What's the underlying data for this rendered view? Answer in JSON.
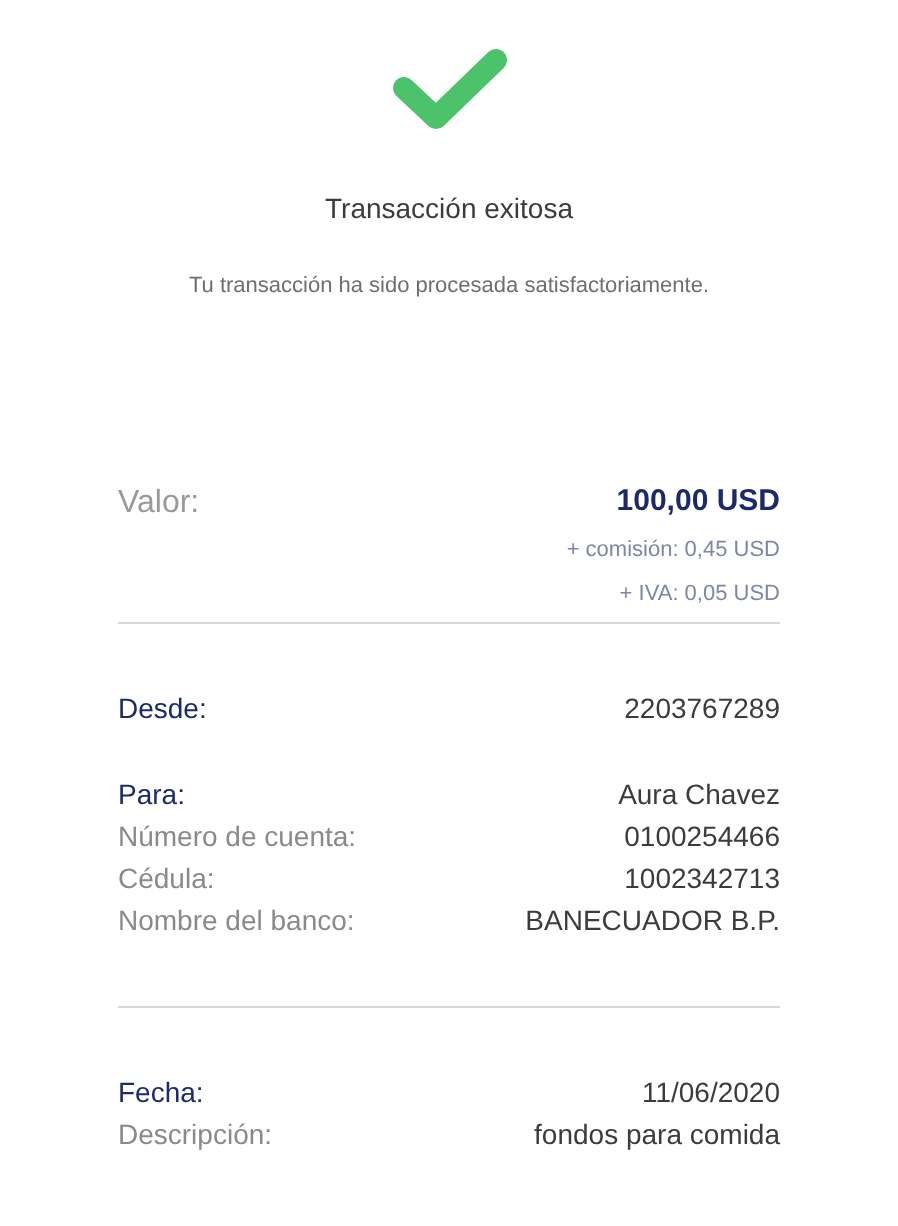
{
  "status": {
    "title": "Transacción exitosa",
    "message": "Tu transacción ha sido procesada satisfactoriamente."
  },
  "amount": {
    "label": "Valor:",
    "value": "100,00 USD",
    "extras": [
      "+ comisión: 0,45 USD",
      "+ IVA: 0,05 USD"
    ]
  },
  "sections": [
    {
      "groups": [
        [
          {
            "kind": "heading",
            "label": "Desde:",
            "value": "2203767289"
          }
        ],
        [
          {
            "kind": "heading",
            "label": "Para:",
            "value": "Aura Chavez"
          },
          {
            "kind": "plain",
            "label": "Número de cuenta:",
            "value": "0100254466"
          },
          {
            "kind": "plain",
            "label": "Cédula:",
            "value": "1002342713"
          },
          {
            "kind": "plain",
            "label": "Nombre del banco:",
            "value": "BANECUADOR B.P."
          }
        ]
      ]
    },
    {
      "groups": [
        [
          {
            "kind": "heading",
            "label": "Fecha:",
            "value": "11/06/2020"
          },
          {
            "kind": "plain",
            "label": "Descripción:",
            "value": "fondos para comida"
          }
        ]
      ]
    }
  ]
}
